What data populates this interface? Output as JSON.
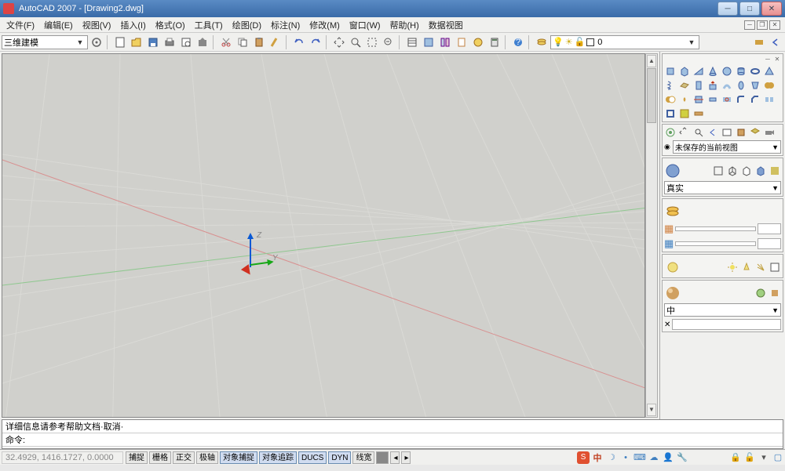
{
  "title": {
    "app": "AutoCAD 2007 - [Drawing2.dwg]"
  },
  "menu": {
    "items": [
      "文件(F)",
      "编辑(E)",
      "视图(V)",
      "插入(I)",
      "格式(O)",
      "工具(T)",
      "绘图(D)",
      "标注(N)",
      "修改(M)",
      "窗口(W)",
      "帮助(H)",
      "数据视图"
    ]
  },
  "toolbar": {
    "workspace": "三维建模",
    "layer_state": "0"
  },
  "right_panels": {
    "view_state": "未保存的当前视图",
    "visual_style": "真实",
    "light_style": "中"
  },
  "axis": {
    "z": "Z",
    "y": "Y"
  },
  "command": {
    "history": "详细信息请参考帮助文档·取消·",
    "prompt": "命令:"
  },
  "status": {
    "coords": "32.4929, 1416.1727, 0.0000",
    "buttons": [
      "捕捉",
      "栅格",
      "正交",
      "极轴",
      "对象捕捉",
      "对象追踪",
      "DUCS",
      "DYN",
      "线宽"
    ],
    "active": [
      4,
      5,
      6,
      7
    ],
    "ime": "中"
  }
}
